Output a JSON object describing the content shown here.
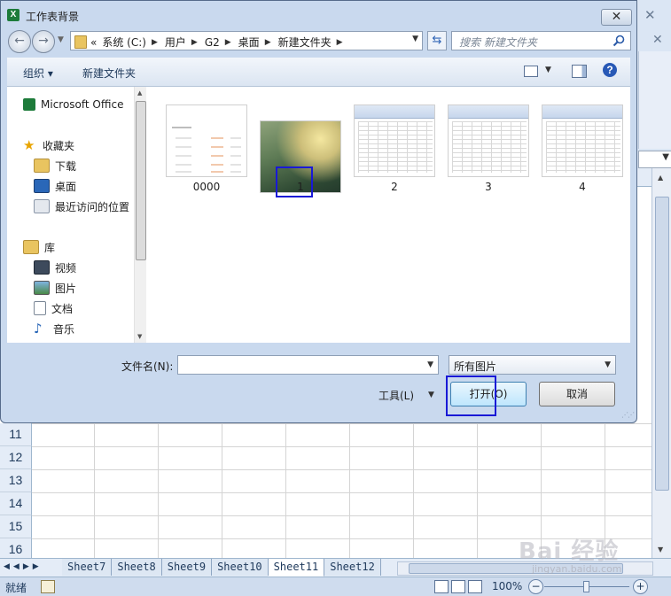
{
  "dialog": {
    "title": "工作表背景",
    "close_label": "✕",
    "address": {
      "prefix": "«",
      "crumbs": [
        "系统 (C:)",
        "用户",
        "G2",
        "桌面",
        "新建文件夹"
      ]
    },
    "search_placeholder": "搜索 新建文件夹",
    "toolbar": {
      "organize": "组织 ▾",
      "new_folder": "新建文件夹",
      "help": "?"
    },
    "nav": {
      "microsoft_office": "Microsoft Office",
      "favorites": "收藏夹",
      "downloads": "下载",
      "desktop": "桌面",
      "recent": "最近访问的位置",
      "libraries": "库",
      "videos": "视频",
      "pictures": "图片",
      "documents": "文档",
      "music": "音乐"
    },
    "files": [
      {
        "name": "0000",
        "kind": "document"
      },
      {
        "name": "1",
        "kind": "photo"
      },
      {
        "name": "2",
        "kind": "spreadsheet"
      },
      {
        "name": "3",
        "kind": "spreadsheet"
      },
      {
        "name": "4",
        "kind": "spreadsheet"
      }
    ],
    "filename_label": "文件名(N):",
    "filename_value": "",
    "filetype_value": "所有图片",
    "tools_label": "工具(L)",
    "open_label": "打开(O)",
    "cancel_label": "取消"
  },
  "excel": {
    "rows": [
      "11",
      "12",
      "13",
      "14",
      "15",
      "16"
    ],
    "sheets": [
      "Sheet7",
      "Sheet8",
      "Sheet9",
      "Sheet10",
      "Sheet11",
      "Sheet12"
    ],
    "active_sheet": "Sheet11",
    "status": "就绪",
    "zoom": "100%"
  },
  "watermark": {
    "logo": "Bai 经验",
    "url": "jingyan.baidu.com"
  },
  "colors": {
    "highlight": "#1919d6",
    "dialog_frame": "#c9d9ee",
    "excel_header": "#e4ecf7"
  }
}
